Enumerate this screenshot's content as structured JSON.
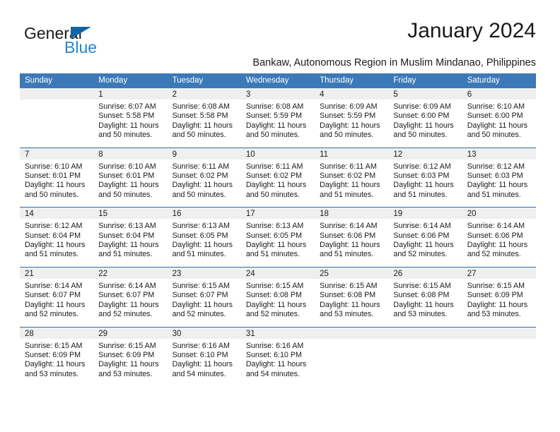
{
  "brand": {
    "name_part1": "General",
    "name_part2": "Blue",
    "triangle_icon": "triangle-icon",
    "colors": {
      "black": "#1a1a1a",
      "blue": "#2585d3",
      "triangle": "#1464a5"
    }
  },
  "header": {
    "month_title": "January 2024",
    "location_subtitle": "Bankaw, Autonomous Region in Muslim Mindanao, Philippines"
  },
  "theme": {
    "header_blue": "#3b79b8",
    "row_divider_blue": "#2f6fae",
    "daynum_band_gray": "#efefef",
    "text": "#1a1a1a"
  },
  "calendar": {
    "weekday_headers": [
      "Sunday",
      "Monday",
      "Tuesday",
      "Wednesday",
      "Thursday",
      "Friday",
      "Saturday"
    ],
    "weeks": [
      [
        {
          "day": "",
          "empty": true,
          "sunrise": "",
          "sunset": "",
          "daylight_line1": "",
          "daylight_line2": ""
        },
        {
          "day": "1",
          "sunrise": "Sunrise: 6:07 AM",
          "sunset": "Sunset: 5:58 PM",
          "daylight_line1": "Daylight: 11 hours",
          "daylight_line2": "and 50 minutes."
        },
        {
          "day": "2",
          "sunrise": "Sunrise: 6:08 AM",
          "sunset": "Sunset: 5:58 PM",
          "daylight_line1": "Daylight: 11 hours",
          "daylight_line2": "and 50 minutes."
        },
        {
          "day": "3",
          "sunrise": "Sunrise: 6:08 AM",
          "sunset": "Sunset: 5:59 PM",
          "daylight_line1": "Daylight: 11 hours",
          "daylight_line2": "and 50 minutes."
        },
        {
          "day": "4",
          "sunrise": "Sunrise: 6:09 AM",
          "sunset": "Sunset: 5:59 PM",
          "daylight_line1": "Daylight: 11 hours",
          "daylight_line2": "and 50 minutes."
        },
        {
          "day": "5",
          "sunrise": "Sunrise: 6:09 AM",
          "sunset": "Sunset: 6:00 PM",
          "daylight_line1": "Daylight: 11 hours",
          "daylight_line2": "and 50 minutes."
        },
        {
          "day": "6",
          "sunrise": "Sunrise: 6:10 AM",
          "sunset": "Sunset: 6:00 PM",
          "daylight_line1": "Daylight: 11 hours",
          "daylight_line2": "and 50 minutes."
        }
      ],
      [
        {
          "day": "7",
          "sunrise": "Sunrise: 6:10 AM",
          "sunset": "Sunset: 6:01 PM",
          "daylight_line1": "Daylight: 11 hours",
          "daylight_line2": "and 50 minutes."
        },
        {
          "day": "8",
          "sunrise": "Sunrise: 6:10 AM",
          "sunset": "Sunset: 6:01 PM",
          "daylight_line1": "Daylight: 11 hours",
          "daylight_line2": "and 50 minutes."
        },
        {
          "day": "9",
          "sunrise": "Sunrise: 6:11 AM",
          "sunset": "Sunset: 6:02 PM",
          "daylight_line1": "Daylight: 11 hours",
          "daylight_line2": "and 50 minutes."
        },
        {
          "day": "10",
          "sunrise": "Sunrise: 6:11 AM",
          "sunset": "Sunset: 6:02 PM",
          "daylight_line1": "Daylight: 11 hours",
          "daylight_line2": "and 50 minutes."
        },
        {
          "day": "11",
          "sunrise": "Sunrise: 6:11 AM",
          "sunset": "Sunset: 6:02 PM",
          "daylight_line1": "Daylight: 11 hours",
          "daylight_line2": "and 51 minutes."
        },
        {
          "day": "12",
          "sunrise": "Sunrise: 6:12 AM",
          "sunset": "Sunset: 6:03 PM",
          "daylight_line1": "Daylight: 11 hours",
          "daylight_line2": "and 51 minutes."
        },
        {
          "day": "13",
          "sunrise": "Sunrise: 6:12 AM",
          "sunset": "Sunset: 6:03 PM",
          "daylight_line1": "Daylight: 11 hours",
          "daylight_line2": "and 51 minutes."
        }
      ],
      [
        {
          "day": "14",
          "sunrise": "Sunrise: 6:12 AM",
          "sunset": "Sunset: 6:04 PM",
          "daylight_line1": "Daylight: 11 hours",
          "daylight_line2": "and 51 minutes."
        },
        {
          "day": "15",
          "sunrise": "Sunrise: 6:13 AM",
          "sunset": "Sunset: 6:04 PM",
          "daylight_line1": "Daylight: 11 hours",
          "daylight_line2": "and 51 minutes."
        },
        {
          "day": "16",
          "sunrise": "Sunrise: 6:13 AM",
          "sunset": "Sunset: 6:05 PM",
          "daylight_line1": "Daylight: 11 hours",
          "daylight_line2": "and 51 minutes."
        },
        {
          "day": "17",
          "sunrise": "Sunrise: 6:13 AM",
          "sunset": "Sunset: 6:05 PM",
          "daylight_line1": "Daylight: 11 hours",
          "daylight_line2": "and 51 minutes."
        },
        {
          "day": "18",
          "sunrise": "Sunrise: 6:14 AM",
          "sunset": "Sunset: 6:06 PM",
          "daylight_line1": "Daylight: 11 hours",
          "daylight_line2": "and 51 minutes."
        },
        {
          "day": "19",
          "sunrise": "Sunrise: 6:14 AM",
          "sunset": "Sunset: 6:06 PM",
          "daylight_line1": "Daylight: 11 hours",
          "daylight_line2": "and 52 minutes."
        },
        {
          "day": "20",
          "sunrise": "Sunrise: 6:14 AM",
          "sunset": "Sunset: 6:06 PM",
          "daylight_line1": "Daylight: 11 hours",
          "daylight_line2": "and 52 minutes."
        }
      ],
      [
        {
          "day": "21",
          "sunrise": "Sunrise: 6:14 AM",
          "sunset": "Sunset: 6:07 PM",
          "daylight_line1": "Daylight: 11 hours",
          "daylight_line2": "and 52 minutes."
        },
        {
          "day": "22",
          "sunrise": "Sunrise: 6:14 AM",
          "sunset": "Sunset: 6:07 PM",
          "daylight_line1": "Daylight: 11 hours",
          "daylight_line2": "and 52 minutes."
        },
        {
          "day": "23",
          "sunrise": "Sunrise: 6:15 AM",
          "sunset": "Sunset: 6:07 PM",
          "daylight_line1": "Daylight: 11 hours",
          "daylight_line2": "and 52 minutes."
        },
        {
          "day": "24",
          "sunrise": "Sunrise: 6:15 AM",
          "sunset": "Sunset: 6:08 PM",
          "daylight_line1": "Daylight: 11 hours",
          "daylight_line2": "and 52 minutes."
        },
        {
          "day": "25",
          "sunrise": "Sunrise: 6:15 AM",
          "sunset": "Sunset: 6:08 PM",
          "daylight_line1": "Daylight: 11 hours",
          "daylight_line2": "and 53 minutes."
        },
        {
          "day": "26",
          "sunrise": "Sunrise: 6:15 AM",
          "sunset": "Sunset: 6:08 PM",
          "daylight_line1": "Daylight: 11 hours",
          "daylight_line2": "and 53 minutes."
        },
        {
          "day": "27",
          "sunrise": "Sunrise: 6:15 AM",
          "sunset": "Sunset: 6:09 PM",
          "daylight_line1": "Daylight: 11 hours",
          "daylight_line2": "and 53 minutes."
        }
      ],
      [
        {
          "day": "28",
          "sunrise": "Sunrise: 6:15 AM",
          "sunset": "Sunset: 6:09 PM",
          "daylight_line1": "Daylight: 11 hours",
          "daylight_line2": "and 53 minutes."
        },
        {
          "day": "29",
          "sunrise": "Sunrise: 6:15 AM",
          "sunset": "Sunset: 6:09 PM",
          "daylight_line1": "Daylight: 11 hours",
          "daylight_line2": "and 53 minutes."
        },
        {
          "day": "30",
          "sunrise": "Sunrise: 6:16 AM",
          "sunset": "Sunset: 6:10 PM",
          "daylight_line1": "Daylight: 11 hours",
          "daylight_line2": "and 54 minutes."
        },
        {
          "day": "31",
          "sunrise": "Sunrise: 6:16 AM",
          "sunset": "Sunset: 6:10 PM",
          "daylight_line1": "Daylight: 11 hours",
          "daylight_line2": "and 54 minutes."
        },
        {
          "day": "",
          "empty": true,
          "sunrise": "",
          "sunset": "",
          "daylight_line1": "",
          "daylight_line2": ""
        },
        {
          "day": "",
          "empty": true,
          "sunrise": "",
          "sunset": "",
          "daylight_line1": "",
          "daylight_line2": ""
        },
        {
          "day": "",
          "empty": true,
          "sunrise": "",
          "sunset": "",
          "daylight_line1": "",
          "daylight_line2": ""
        }
      ]
    ]
  }
}
